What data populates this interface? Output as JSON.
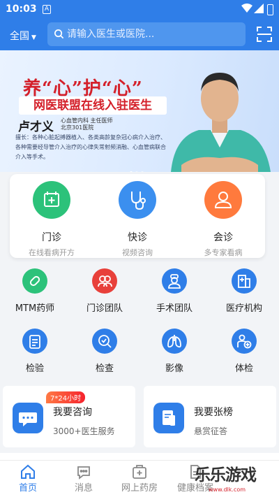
{
  "status_bar": {
    "time": "10:03",
    "notif_letter": "A"
  },
  "header": {
    "region": "全国",
    "search_placeholder": "请输入医生或医院..."
  },
  "banner": {
    "title": "养“心”护“心”",
    "subtitle": "网医联盟在线入驻医生",
    "doctor_name": "卢才义",
    "doctor_role_line1": "心血管内科 主任医师",
    "doctor_role_line2": "北京301医院",
    "description": "擅长：各种心脏起搏器植入、各类高龄复杂冠心病介入治疗、各种需要经导管介入治疗的心律失常射频消融、心血管病联合介入等手术。"
  },
  "services": [
    {
      "title": "门诊",
      "subtitle": "在线看病开方",
      "icon": "calendar-plus-icon",
      "color": "#2cc27a"
    },
    {
      "title": "快诊",
      "subtitle": "视频咨询",
      "icon": "stethoscope-icon",
      "color": "#3b8fef"
    },
    {
      "title": "会诊",
      "subtitle": "多专家看病",
      "icon": "group-icon",
      "color": "#ff7a3d"
    }
  ],
  "grid": [
    {
      "label": "MTM药师",
      "icon": "pill-icon",
      "color": "#2cc27a"
    },
    {
      "label": "门诊团队",
      "icon": "team-icon",
      "color": "#e8403a"
    },
    {
      "label": "手术团队",
      "icon": "surgeon-icon",
      "color": "#2f7ee8"
    },
    {
      "label": "医疗机构",
      "icon": "hospital-icon",
      "color": "#2f7ee8"
    },
    {
      "label": "检验",
      "icon": "clipboard-icon",
      "color": "#2f7ee8"
    },
    {
      "label": "检查",
      "icon": "magnifier-icon",
      "color": "#2f7ee8"
    },
    {
      "label": "影像",
      "icon": "lungs-icon",
      "color": "#2f7ee8"
    },
    {
      "label": "体检",
      "icon": "person-plus-icon",
      "color": "#2f7ee8"
    }
  ],
  "consult": {
    "badge": "7*24小时",
    "title": "我要咨询",
    "subtitle": "3000+医生服务"
  },
  "bounty": {
    "title": "我要张榜",
    "subtitle": "悬赏征答"
  },
  "tabs": [
    {
      "label": "首页",
      "icon": "home-icon",
      "active": true
    },
    {
      "label": "消息",
      "icon": "message-icon",
      "active": false
    },
    {
      "label": "网上药房",
      "icon": "pharmacy-icon",
      "active": false
    },
    {
      "label": "健康档案",
      "icon": "file-icon",
      "active": false
    }
  ],
  "watermark": {
    "brand": "乐乐游戏",
    "url": "www.dlk.com"
  },
  "colors": {
    "primary": "#2f7ee8",
    "accent_red": "#d4202a"
  }
}
